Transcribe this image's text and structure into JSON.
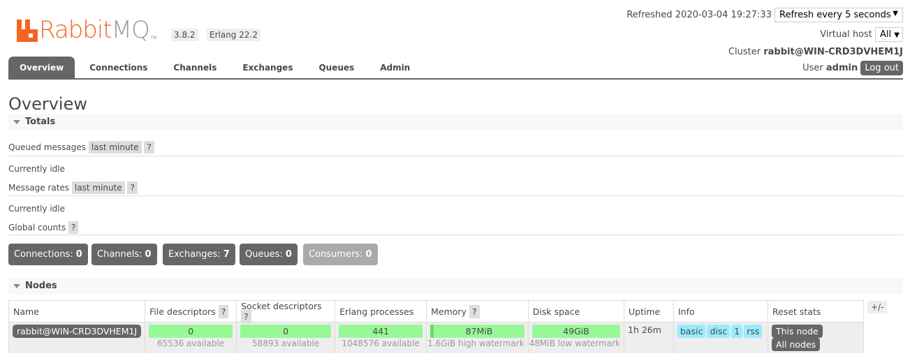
{
  "header": {
    "logo_text_a": "Rabbit",
    "logo_text_b": "MQ",
    "trademark": "TM",
    "version": "3.8.2",
    "erlang": "Erlang 22.2",
    "refreshed": "Refreshed 2020-03-04 19:27:33",
    "refresh_select": "Refresh every 5 seconds",
    "vhost_label": "Virtual host",
    "vhost_value": "All",
    "cluster_label": "Cluster",
    "cluster_name": "rabbit@WIN-CRD3DVHEM1J",
    "user_label": "User",
    "user_name": "admin",
    "logout": "Log out"
  },
  "tabs": [
    {
      "label": "Overview",
      "active": true
    },
    {
      "label": "Connections"
    },
    {
      "label": "Channels"
    },
    {
      "label": "Exchanges"
    },
    {
      "label": "Queues"
    },
    {
      "label": "Admin"
    }
  ],
  "page_title": "Overview",
  "totals": {
    "title": "Totals",
    "queued_label": "Queued messages",
    "queued_range": "last minute",
    "help": "?",
    "idle1": "Currently idle",
    "rates_label": "Message rates",
    "rates_range": "last minute",
    "idle2": "Currently idle",
    "global_label": "Global counts",
    "counts": [
      {
        "label": "Connections:",
        "value": "0"
      },
      {
        "label": "Channels:",
        "value": "0"
      },
      {
        "label": "Exchanges:",
        "value": "7"
      },
      {
        "label": "Queues:",
        "value": "0"
      },
      {
        "label": "Consumers:",
        "value": "0",
        "disabled": true
      }
    ]
  },
  "nodes": {
    "title": "Nodes",
    "columns": [
      "Name",
      "File descriptors",
      "Socket descriptors",
      "Erlang processes",
      "Memory",
      "Disk space",
      "Uptime",
      "Info",
      "Reset stats"
    ],
    "plusminus": "+/-",
    "rows": [
      {
        "name": "rabbit@WIN-CRD3DVHEM1J",
        "fd": "0",
        "fd_avail": "65536 available",
        "sd": "0",
        "sd_avail": "58893 available",
        "ep": "441",
        "ep_avail": "1048576 available",
        "mem": "87MiB",
        "mem_sub": "1.6GiB high watermark",
        "disk": "49GiB",
        "disk_sub": "48MiB low watermark",
        "uptime": "1h 26m",
        "info": [
          "basic",
          "disc",
          "1",
          "rss"
        ],
        "reset_this": "This node",
        "reset_all": "All nodes"
      }
    ]
  },
  "colors": {
    "brand": "#f26522",
    "tab_active": "#666666",
    "bar_ok": "#98f898",
    "info_badge": "#99ebff"
  }
}
